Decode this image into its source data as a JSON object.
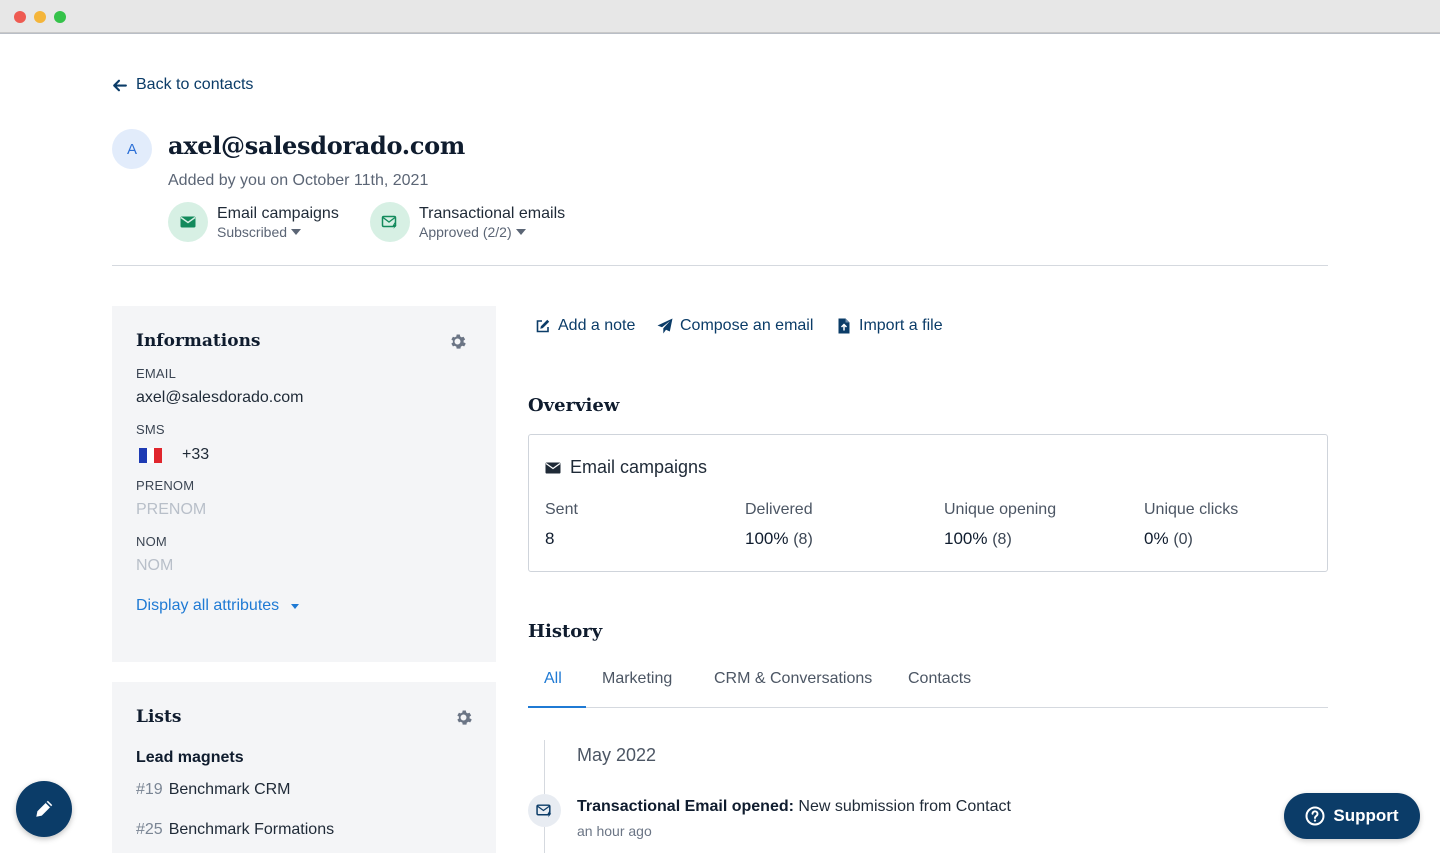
{
  "colors": {
    "navy": "#0b3c68",
    "link_blue": "#1f7ad4",
    "green_bg": "#d7f0e4",
    "green_icon": "#138a5c",
    "panel_bg": "#f4f5f7"
  },
  "back_link": {
    "label": "Back to contacts",
    "icon": "arrow-left-icon"
  },
  "contact": {
    "avatar_initial": "A",
    "email": "axel@salesdorado.com",
    "added": "Added by you on October 11th, 2021"
  },
  "subscriptions": [
    {
      "label": "Email campaigns",
      "status": "Subscribed",
      "icon": "envelope-icon"
    },
    {
      "label": "Transactional emails",
      "status": "Approved (2/2)",
      "icon": "envelope-bolt-icon"
    }
  ],
  "informations": {
    "title": "Informations",
    "email_label": "EMAIL",
    "email_value": "axel@salesdorado.com",
    "sms_label": "SMS",
    "sms_value": "+33",
    "prenom_label": "PRENOM",
    "prenom_placeholder": "PRENOM",
    "nom_label": "NOM",
    "nom_placeholder": "NOM",
    "display_all": "Display all attributes"
  },
  "lists": {
    "title": "Lists",
    "group": "Lead magnets",
    "items": [
      {
        "num": "#19",
        "name": "Benchmark CRM"
      },
      {
        "num": "#25",
        "name": "Benchmark Formations"
      }
    ]
  },
  "actions": [
    {
      "label": "Add a note",
      "icon": "edit-icon"
    },
    {
      "label": "Compose an email",
      "icon": "paper-plane-icon"
    },
    {
      "label": "Import a file",
      "icon": "file-upload-icon"
    }
  ],
  "overview": {
    "title": "Overview",
    "card_title": "Email campaigns",
    "stats": [
      {
        "label": "Sent",
        "value": "8",
        "count": ""
      },
      {
        "label": "Delivered",
        "value": "100%",
        "count": "(8)"
      },
      {
        "label": "Unique opening",
        "value": "100%",
        "count": "(8)"
      },
      {
        "label": "Unique clicks",
        "value": "0%",
        "count": "(0)"
      }
    ]
  },
  "history": {
    "title": "History",
    "tabs": [
      "All",
      "Marketing",
      "CRM & Conversations",
      "Contacts"
    ],
    "active_tab": "All",
    "month": "May 2022",
    "event": {
      "type": "Transactional Email opened:",
      "text": "New submission from Contact",
      "time": "an hour ago"
    }
  },
  "support_label": "Support"
}
